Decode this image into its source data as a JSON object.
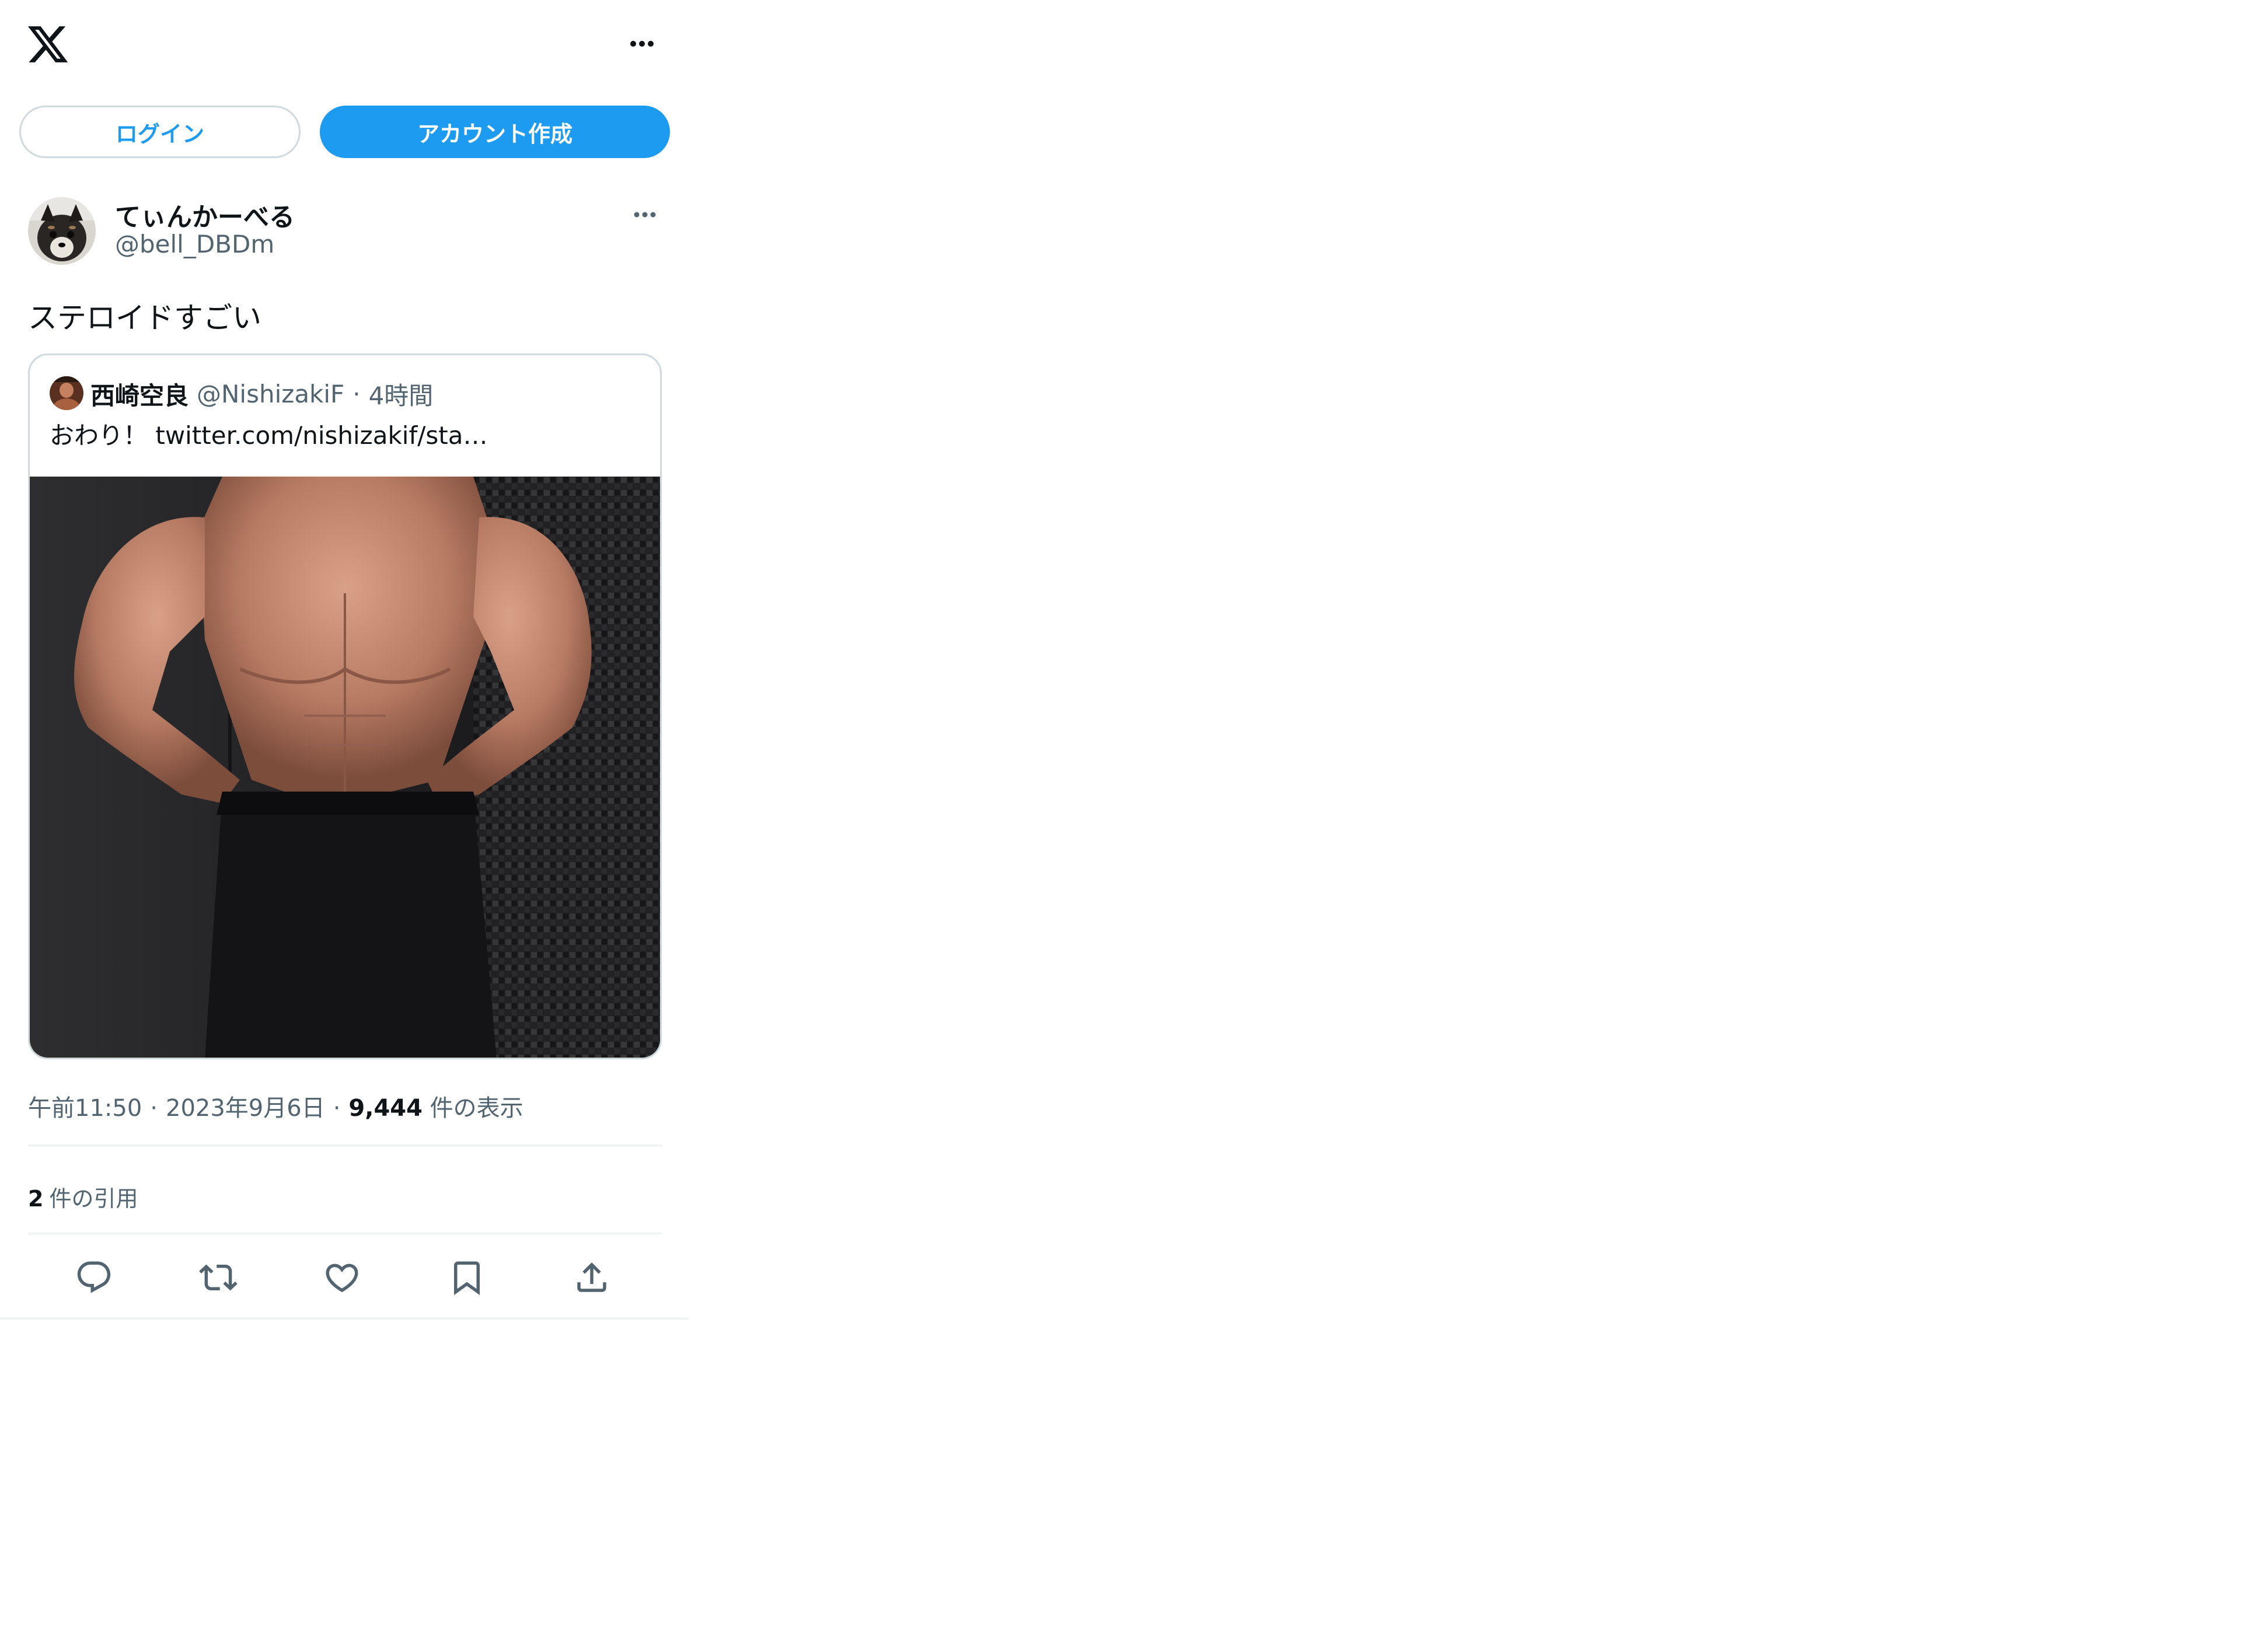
{
  "header": {
    "login_label": "ログイン",
    "signup_label": "アカウント作成"
  },
  "post": {
    "display_name": "てぃんかーべる",
    "handle": "@bell_DBDm",
    "text": "ステロイドすごい",
    "quoted": {
      "display_name": "西崎空良",
      "handle": "@NishizakiF",
      "separator": "·",
      "time": "4時間",
      "text": "おわり！  twitter.com/nishizakif/sta…"
    },
    "meta": {
      "time": "午前11:50",
      "separator1": "·",
      "date": "2023年9月6日",
      "separator2": "·",
      "views": "9,444",
      "views_label": "件の表示"
    },
    "quotes": {
      "count": "2",
      "label": "件の引用"
    }
  },
  "icons": {
    "logo": "x-logo-icon",
    "more": "more-icon",
    "reply": "reply-icon",
    "retweet": "retweet-icon",
    "like": "like-icon",
    "bookmark": "bookmark-icon",
    "share": "share-icon"
  },
  "colors": {
    "accent": "#1d9bf0",
    "text": "#0f1419",
    "secondary": "#536471",
    "border": "#cfd9de"
  }
}
